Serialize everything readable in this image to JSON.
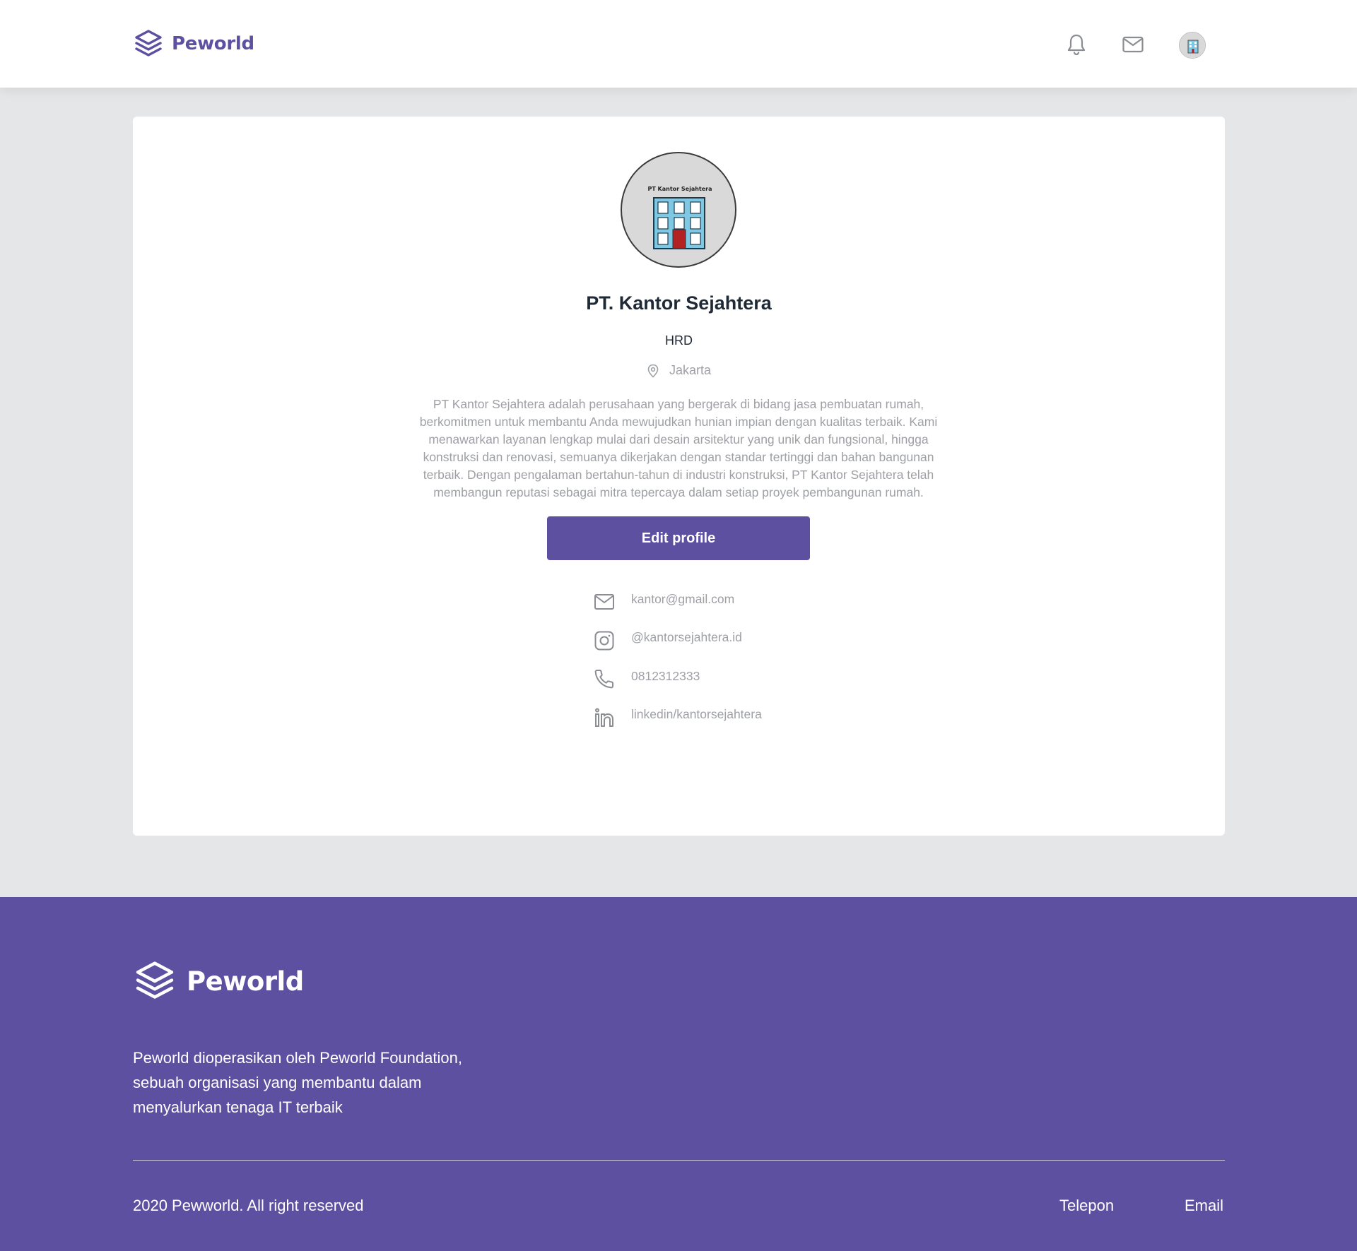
{
  "navbar": {
    "brand": "Peworld",
    "icons": [
      "layers-logo-icon",
      "bell-icon",
      "mail-icon",
      "avatar"
    ]
  },
  "profile": {
    "photo_caption": "PT Kantor Sejahtera",
    "name": "PT. Kantor Sejahtera",
    "field": "HRD",
    "location": "Jakarta",
    "description": "PT Kantor Sejahtera adalah perusahaan yang bergerak di bidang jasa pembuatan rumah, berkomitmen untuk membantu Anda mewujudkan hunian impian dengan kualitas terbaik. Kami menawarkan layanan lengkap mulai dari desain arsitektur yang unik dan fungsional, hingga konstruksi dan renovasi, semuanya dikerjakan dengan standar tertinggi dan bahan bangunan terbaik. Dengan pengalaman bertahun-tahun di industri konstruksi, PT Kantor Sejahtera telah membangun reputasi sebagai mitra tepercaya dalam setiap proyek pembangunan rumah.",
    "edit_label": "Edit profile",
    "contacts": [
      {
        "icon": "mail-icon",
        "text": "kantor@gmail.com"
      },
      {
        "icon": "instagram-icon",
        "text": "@kantorsejahtera.id"
      },
      {
        "icon": "phone-icon",
        "text": "0812312333"
      },
      {
        "icon": "linkedin-icon",
        "text": "linkedin/kantorsejahtera"
      }
    ]
  },
  "footer": {
    "brand": "Peworld",
    "description": "Peworld dioperasikan oleh Peworld Foundation, sebuah organisasi yang membantu dalam menyalurkan tenaga IT terbaik",
    "copyright": "2020 Pewworld. All right reserved",
    "links": [
      "Telepon",
      "Email"
    ]
  },
  "colors": {
    "brand": "#5E50A1",
    "background": "#E5E6E8",
    "muted_text": "#9EA0A5"
  }
}
